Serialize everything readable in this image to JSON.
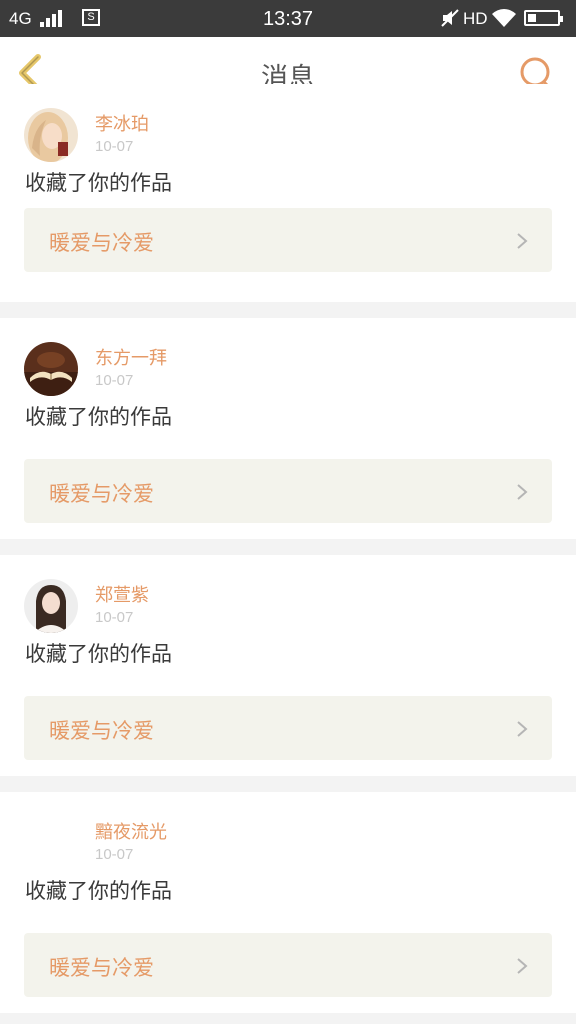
{
  "status_bar": {
    "network": "4G",
    "time": "13:37",
    "hd": "HD"
  },
  "header": {
    "title": "消息"
  },
  "messages": [
    {
      "user": "李冰珀",
      "date": "10-07",
      "action": "收藏了你的作品",
      "work": "暖爱与冷爱",
      "avatar": "avatar-blonde-girl"
    },
    {
      "user": "东方一拜",
      "date": "10-07",
      "action": "收藏了你的作品",
      "work": "暖爱与冷爱",
      "avatar": "avatar-open-book"
    },
    {
      "user": "郑萱紫",
      "date": "10-07",
      "action": "收藏了你的作品",
      "work": "暖爱与冷爱",
      "avatar": "avatar-girl-portrait"
    },
    {
      "user": "黯夜流光",
      "date": "10-07",
      "action": "收藏了你的作品",
      "work": "暖爱与冷爱",
      "avatar": ""
    }
  ],
  "colors": {
    "accent": "#e59a67",
    "back_arrow": "#e6c76a",
    "status_bar": "#3b3b3b",
    "work_background": "#f3f3ec"
  }
}
